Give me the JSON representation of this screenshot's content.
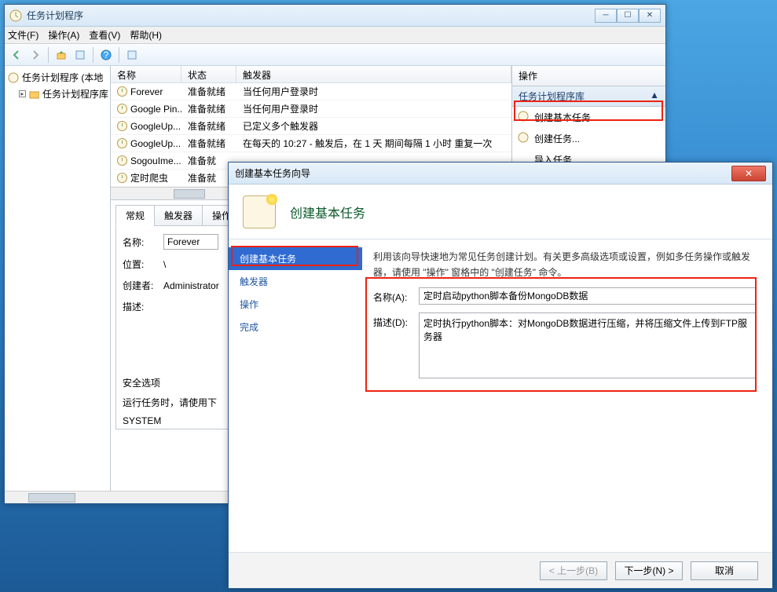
{
  "window": {
    "title": "任务计划程序",
    "menu": {
      "file": "文件(F)",
      "action": "操作(A)",
      "view": "查看(V)",
      "help": "帮助(H)"
    }
  },
  "tree": {
    "root": "任务计划程序 (本地",
    "child": "任务计划程序库"
  },
  "list": {
    "headers": {
      "name": "名称",
      "status": "状态",
      "trigger": "触发器"
    },
    "rows": [
      {
        "name": "Forever",
        "status": "准备就绪",
        "trigger": "当任何用户登录时"
      },
      {
        "name": "Google Pin...",
        "status": "准备就绪",
        "trigger": "当任何用户登录时"
      },
      {
        "name": "GoogleUp...",
        "status": "准备就绪",
        "trigger": "已定义多个触发器"
      },
      {
        "name": "GoogleUp...",
        "status": "准备就绪",
        "trigger": "在每天的 10:27 - 触发后，在 1 天 期间每隔 1 小时 重复一次"
      },
      {
        "name": "SogouIme...",
        "status": "准备就",
        "trigger": ""
      },
      {
        "name": "定时爬虫",
        "status": "准备就",
        "trigger": ""
      }
    ]
  },
  "detail": {
    "tabs": {
      "general": "常规",
      "trigger": "触发器",
      "action": "操作"
    },
    "name_lbl": "名称:",
    "name_val": "Forever",
    "loc_lbl": "位置:",
    "loc_val": "\\",
    "creator_lbl": "创建者:",
    "creator_val": "Administrator",
    "desc_lbl": "描述:",
    "security_lbl": "安全选项",
    "runwhen": "运行任务时，请使用下",
    "account": "SYSTEM"
  },
  "actions": {
    "header": "操作",
    "subheader": "任务计划程序库",
    "items": [
      "创建基本任务...",
      "创建任务...",
      "导入任务..."
    ]
  },
  "wizard": {
    "title": "创建基本任务向导",
    "heading": "创建基本任务",
    "steps": {
      "s1": "创建基本任务",
      "s2": "触发器",
      "s3": "操作",
      "s4": "完成"
    },
    "intro": "利用该向导快速地为常见任务创建计划。有关更多高级选项或设置，例如多任务操作或触发器，请使用 \"操作\" 窗格中的 \"创建任务\" 命令。",
    "name_lbl": "名称(A):",
    "name_val": "定时启动python脚本备份MongoDB数据",
    "desc_lbl": "描述(D):",
    "desc_val": "定时执行python脚本：对MongoDB数据进行压缩，并将压缩文件上传到FTP服务器",
    "btn_back": "< 上一步(B)",
    "btn_next": "下一步(N) >",
    "btn_cancel": "取消"
  }
}
